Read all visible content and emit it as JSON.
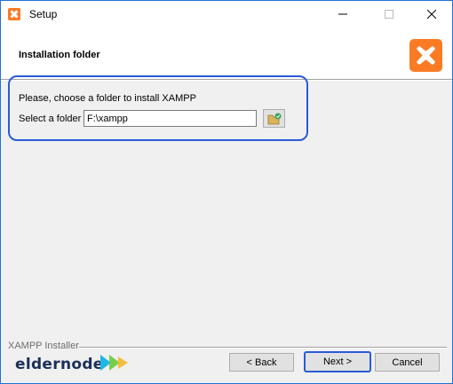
{
  "window": {
    "title": "Setup",
    "accent": "#1e73d6"
  },
  "header": {
    "title": "Installation folder",
    "logo_icon": "xampp-logo-icon",
    "brand_color": "#fb7a24"
  },
  "content": {
    "instruction": "Please, choose a folder to install XAMPP",
    "folder_label": "Select a folder",
    "folder_value": "F:\\xampp",
    "browse_icon": "folder-browse-icon"
  },
  "footer": {
    "installer_label": "XAMPP Installer",
    "brand_text": "eldernode",
    "back_label": "< Back",
    "next_label": "Next >",
    "cancel_label": "Cancel"
  }
}
